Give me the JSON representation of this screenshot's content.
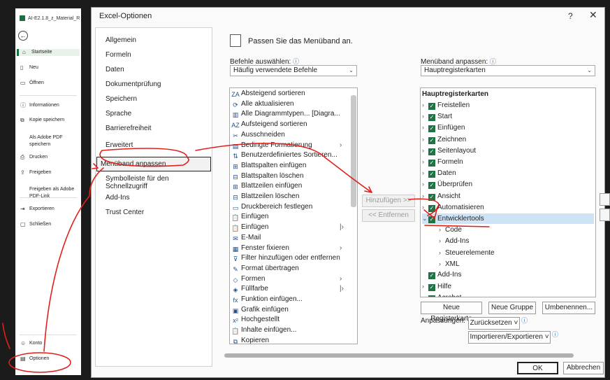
{
  "backstage": {
    "file_name": "AI-E2.1.8_z_Material_R",
    "items": [
      {
        "label": "Startseite",
        "icon": "home-icon"
      },
      {
        "label": "Neu",
        "icon": "new-doc-icon"
      },
      {
        "label": "Öffnen",
        "icon": "folder-icon"
      },
      {
        "label": "Informationen",
        "icon": "info-icon"
      },
      {
        "label": "Kopie speichern",
        "icon": "copy-icon"
      },
      {
        "label": "Als Adobe PDF speichern",
        "icon": ""
      },
      {
        "label": "Drucken",
        "icon": "print-icon"
      },
      {
        "label": "Freigeben",
        "icon": "share-icon"
      },
      {
        "label": "Freigeben als Adobe PDF-Link",
        "icon": ""
      },
      {
        "label": "Exportieren",
        "icon": "export-icon"
      },
      {
        "label": "Schließen",
        "icon": "close-doc-icon"
      },
      {
        "label": "Konto",
        "icon": "account-icon"
      },
      {
        "label": "Optionen",
        "icon": "options-icon"
      }
    ]
  },
  "dialog": {
    "title": "Excel-Optionen",
    "help": "?",
    "close": "✕",
    "nav": [
      "Allgemein",
      "Formeln",
      "Daten",
      "Dokumentprüfung",
      "Speichern",
      "Sprache",
      "Barrierefreiheit",
      "Erweitert",
      "Menüband anpassen",
      "Symbolleiste für den Schnellzugriff",
      "Add-Ins",
      "Trust Center"
    ],
    "header_text": "Passen Sie das Menüband an.",
    "left_label": "Befehle auswählen:",
    "left_dropdown": "Häufig verwendete Befehle",
    "right_label": "Menüband anpassen:",
    "right_dropdown": "Hauptregisterkarten",
    "commands": [
      {
        "label": "Absteigend sortieren",
        "icon": "ZA"
      },
      {
        "label": "Alle aktualisieren",
        "icon": "⟳"
      },
      {
        "label": "Alle Diagrammtypen... [Diagra...",
        "icon": "▥"
      },
      {
        "label": "Aufsteigend sortieren",
        "icon": "AZ"
      },
      {
        "label": "Ausschneiden",
        "icon": "✂"
      },
      {
        "label": "Bedingte Formatierung",
        "icon": "▤",
        "sub": "›"
      },
      {
        "label": "Benutzerdefiniertes Sortieren...",
        "icon": "⇅"
      },
      {
        "label": "Blattspalten einfügen",
        "icon": "⊞"
      },
      {
        "label": "Blattspalten löschen",
        "icon": "⊟"
      },
      {
        "label": "Blattzeilen einfügen",
        "icon": "⊞"
      },
      {
        "label": "Blattzeilen löschen",
        "icon": "⊟"
      },
      {
        "label": "Druckbereich festlegen",
        "icon": "▭"
      },
      {
        "label": "Einfügen",
        "icon": "📋"
      },
      {
        "label": "Einfügen",
        "icon": "📋",
        "sub": "|›"
      },
      {
        "label": "E-Mail",
        "icon": "✉"
      },
      {
        "label": "Fenster fixieren",
        "icon": "▦",
        "sub": "›"
      },
      {
        "label": "Filter hinzufügen oder entfernen",
        "icon": "⊽"
      },
      {
        "label": "Format übertragen",
        "icon": "✎"
      },
      {
        "label": "Formen",
        "icon": "◇",
        "sub": "›"
      },
      {
        "label": "Füllfarbe",
        "icon": "◈",
        "sub": "|›"
      },
      {
        "label": "Funktion einfügen...",
        "icon": "fx"
      },
      {
        "label": "Grafik einfügen",
        "icon": "▣"
      },
      {
        "label": "Hochgestellt",
        "icon": "x²"
      },
      {
        "label": "Inhalte einfügen...",
        "icon": "📋"
      },
      {
        "label": "Kopieren",
        "icon": "⧉"
      }
    ],
    "add_button": "Hinzufügen >>",
    "remove_button": "<< Entfernen",
    "tree_header": "Hauptregisterkarten",
    "tree": [
      {
        "label": "Freistellen",
        "level": 0,
        "toggle": "›",
        "checked": true
      },
      {
        "label": "Start",
        "level": 0,
        "toggle": "›",
        "checked": true
      },
      {
        "label": "Einfügen",
        "level": 0,
        "toggle": "›",
        "checked": true
      },
      {
        "label": "Zeichnen",
        "level": 0,
        "toggle": "›",
        "checked": true
      },
      {
        "label": "Seitenlayout",
        "level": 0,
        "toggle": "›",
        "checked": true
      },
      {
        "label": "Formeln",
        "level": 0,
        "toggle": "›",
        "checked": true
      },
      {
        "label": "Daten",
        "level": 0,
        "toggle": "›",
        "checked": true
      },
      {
        "label": "Überprüfen",
        "level": 0,
        "toggle": "›",
        "checked": true
      },
      {
        "label": "Ansicht",
        "level": 0,
        "toggle": "›",
        "checked": true
      },
      {
        "label": "Automatisieren",
        "level": 0,
        "toggle": "›",
        "checked": true
      },
      {
        "label": "Entwicklertools",
        "level": 0,
        "toggle": "⌄",
        "checked": true,
        "selected": true
      },
      {
        "label": "Code",
        "level": 1,
        "toggle": "›",
        "checked": false
      },
      {
        "label": "Add-Ins",
        "level": 1,
        "toggle": "›",
        "checked": false
      },
      {
        "label": "Steuerelemente",
        "level": 1,
        "toggle": "›",
        "checked": false
      },
      {
        "label": "XML",
        "level": 1,
        "toggle": "›",
        "checked": false
      },
      {
        "label": "Add-Ins",
        "level": 0,
        "toggle": "",
        "checked": true
      },
      {
        "label": "Hilfe",
        "level": 0,
        "toggle": "›",
        "checked": true
      },
      {
        "label": "Acrobat",
        "level": 0,
        "toggle": "›",
        "checked": true
      }
    ],
    "new_tab": "Neue Registerkarte",
    "new_group": "Neue Gruppe",
    "rename": "Umbenennen...",
    "customizations_label": "Anpassungen:",
    "reset": "Zurücksetzen ˅",
    "import_export": "Importieren/Exportieren ˅",
    "ok": "OK",
    "cancel": "Abbrechen",
    "info_glyph": "ⓘ"
  },
  "colors": {
    "accent": "#217346",
    "annotation": "#e0201b",
    "selection": "#cfe3f6"
  }
}
